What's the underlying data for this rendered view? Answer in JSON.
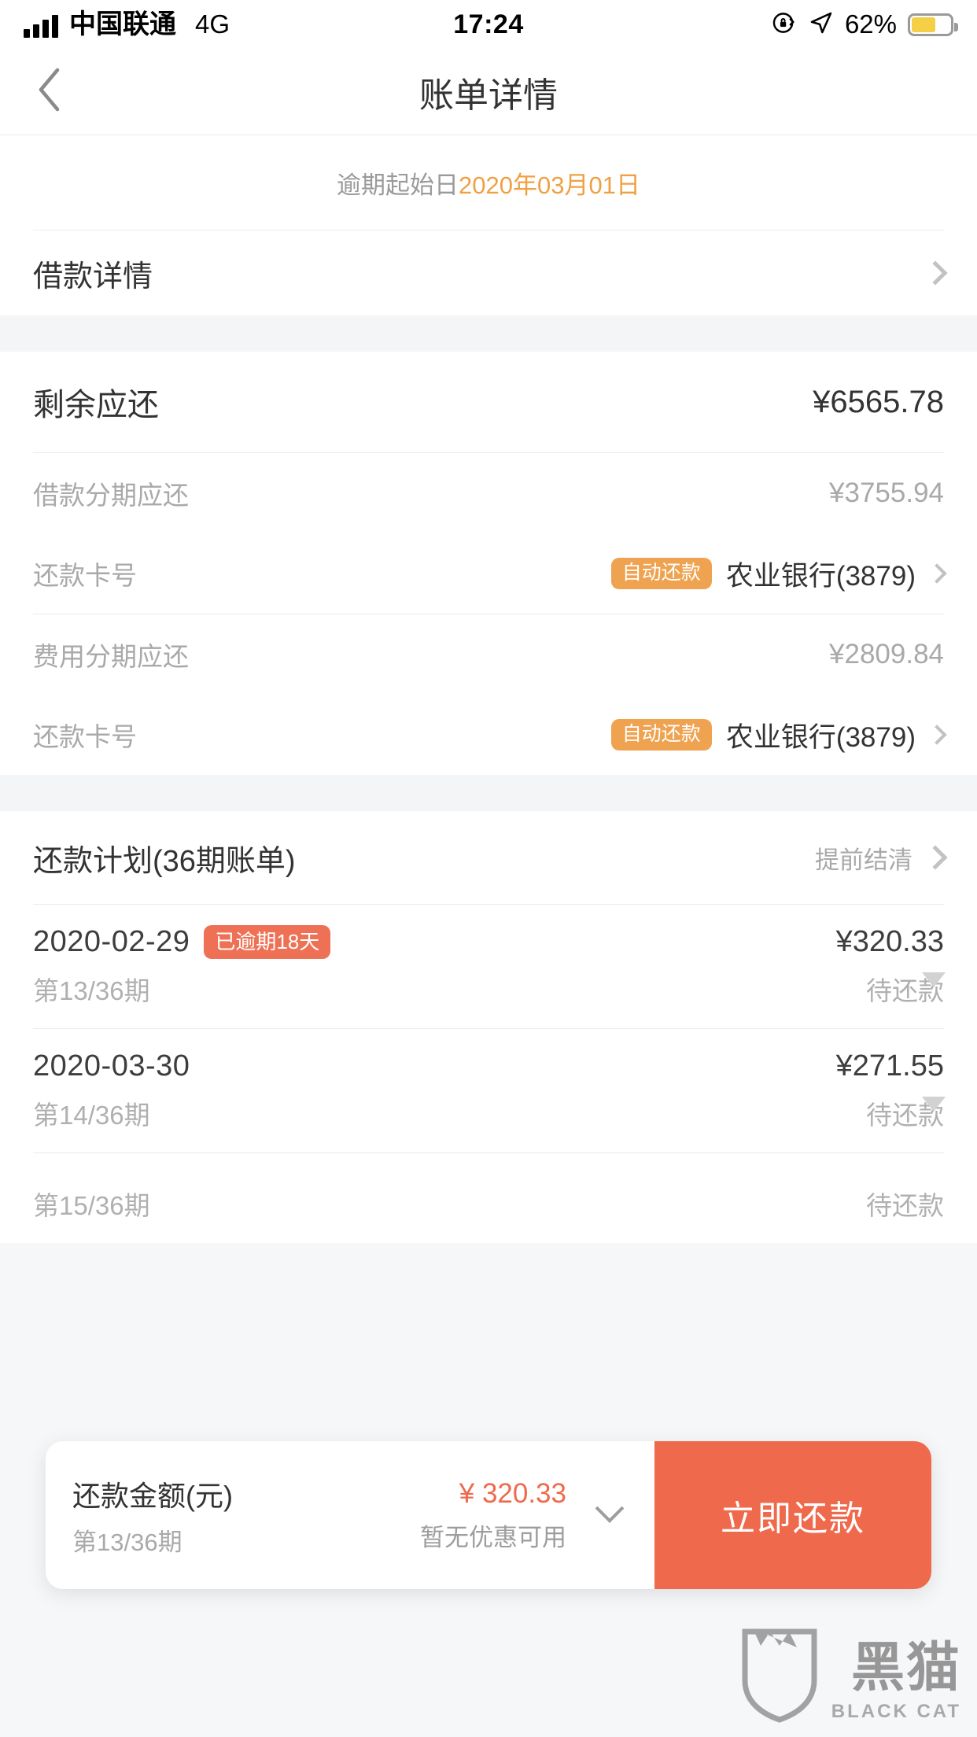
{
  "status_bar": {
    "carrier": "中国联通",
    "network": "4G",
    "time": "17:24",
    "battery_percent": "62%",
    "battery_level": 62,
    "icons": [
      "signal-bars-icon",
      "rotation-lock-icon",
      "location-arrow-icon",
      "battery-icon"
    ]
  },
  "nav": {
    "back_icon": "chevron-left-icon",
    "title": "账单详情"
  },
  "overdue_banner": {
    "label": "逾期起始日",
    "date": "2020年03月01日",
    "date_color": "#f0a044"
  },
  "loan_detail_row": {
    "label": "借款详情",
    "chevron": "chevron-right-icon"
  },
  "summary": {
    "remaining": {
      "label": "剩余应还",
      "value": "¥6565.78"
    },
    "sections": [
      {
        "amount_label": "借款分期应还",
        "amount_value": "¥3755.94",
        "card_label": "还款卡号",
        "badge": "自动还款",
        "bank": "农业银行(3879)",
        "chevron": "chevron-right-icon"
      },
      {
        "amount_label": "费用分期应还",
        "amount_value": "¥2809.84",
        "card_label": "还款卡号",
        "badge": "自动还款",
        "bank": "农业银行(3879)",
        "chevron": "chevron-right-icon"
      }
    ]
  },
  "plan": {
    "title": "还款计划(36期账单)",
    "action": "提前结清",
    "action_chevron": "chevron-right-icon",
    "items": [
      {
        "date": "2020-02-29",
        "badge": "已逾期18天",
        "amount": "¥320.33",
        "term": "第13/36期",
        "status": "待还款",
        "caret": "caret-down-icon"
      },
      {
        "date": "2020-03-30",
        "badge": "",
        "amount": "¥271.55",
        "term": "第14/36期",
        "status": "待还款",
        "caret": "caret-down-icon"
      },
      {
        "date": "",
        "badge": "",
        "amount": "",
        "term": "第15/36期",
        "status": "待还款",
        "caret": ""
      }
    ]
  },
  "bottom_bar": {
    "title": "还款金额(元)",
    "term": "第13/36期",
    "price": "¥ 320.33",
    "promo": "暂无优惠可用",
    "expand_icon": "chevron-down-icon",
    "button": "立即还款",
    "button_color": "#ef6a4c"
  },
  "watermark": {
    "cn": "黑猫",
    "en": "BLACK CAT",
    "icon": "cat-shield-icon"
  },
  "colors": {
    "accent_orange": "#efa350",
    "accent_red": "#ef6a4c",
    "badge_overdue": "#ef7155",
    "page_bg": "#f4f5f7"
  }
}
